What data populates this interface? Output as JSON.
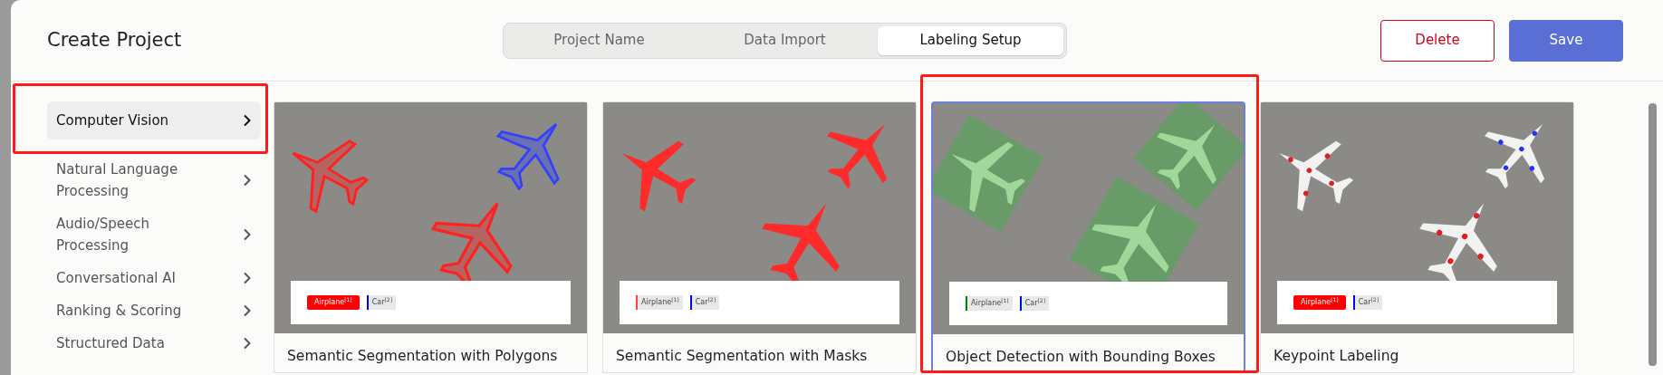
{
  "title": "Create Project",
  "steps": [
    {
      "label": "Project Name",
      "selected": false
    },
    {
      "label": "Data Import",
      "selected": false
    },
    {
      "label": "Labeling Setup",
      "selected": true
    }
  ],
  "buttons": [
    {
      "label": "Delete",
      "kind": "danger"
    },
    {
      "label": "Save",
      "kind": "primary"
    }
  ],
  "sidebar": {
    "items": [
      {
        "label": "Computer Vision",
        "selected": true,
        "highlighted": true
      },
      {
        "label": "Natural Language Processing",
        "selected": false,
        "highlighted": false
      },
      {
        "label": "Audio/Speech Processing",
        "selected": false,
        "highlighted": false
      },
      {
        "label": "Conversational AI",
        "selected": false,
        "highlighted": false
      },
      {
        "label": "Ranking & Scoring",
        "selected": false,
        "highlighted": false
      },
      {
        "label": "Structured Data",
        "selected": false,
        "highlighted": false
      }
    ]
  },
  "templates": [
    {
      "title": "Semantic Segmentation with Polygons",
      "kind": "polygon",
      "selected": false,
      "highlighted": false,
      "tags": [
        {
          "label": "Airplane",
          "hotkey": "[1]",
          "color": "#ff0000",
          "kind": "filled"
        },
        {
          "label": "Car",
          "hotkey": "[2]",
          "color": "#0000ff",
          "kind": "bar"
        }
      ]
    },
    {
      "title": "Semantic Segmentation with Masks",
      "kind": "mask",
      "selected": false,
      "highlighted": false,
      "tags": [
        {
          "label": "Airplane",
          "hotkey": "[1]",
          "color": "#ff4444",
          "kind": "bar"
        },
        {
          "label": "Car",
          "hotkey": "[2]",
          "color": "#0000ff",
          "kind": "bar"
        }
      ]
    },
    {
      "title": "Object Detection with Bounding Boxes",
      "kind": "bbox",
      "selected": true,
      "highlighted": true,
      "tags": [
        {
          "label": "Airplane",
          "hotkey": "[1]",
          "color": "#008000",
          "kind": "bar"
        },
        {
          "label": "Car",
          "hotkey": "[2]",
          "color": "#0000ff",
          "kind": "bar"
        }
      ]
    },
    {
      "title": "Keypoint Labeling",
      "kind": "keypoint",
      "selected": false,
      "highlighted": false,
      "tags": [
        {
          "label": "Airplane",
          "hotkey": "[1]",
          "color": "#ff0000",
          "kind": "filled"
        },
        {
          "label": "Car",
          "hotkey": "[2]",
          "color": "#0000ff",
          "kind": "bar"
        }
      ]
    }
  ]
}
